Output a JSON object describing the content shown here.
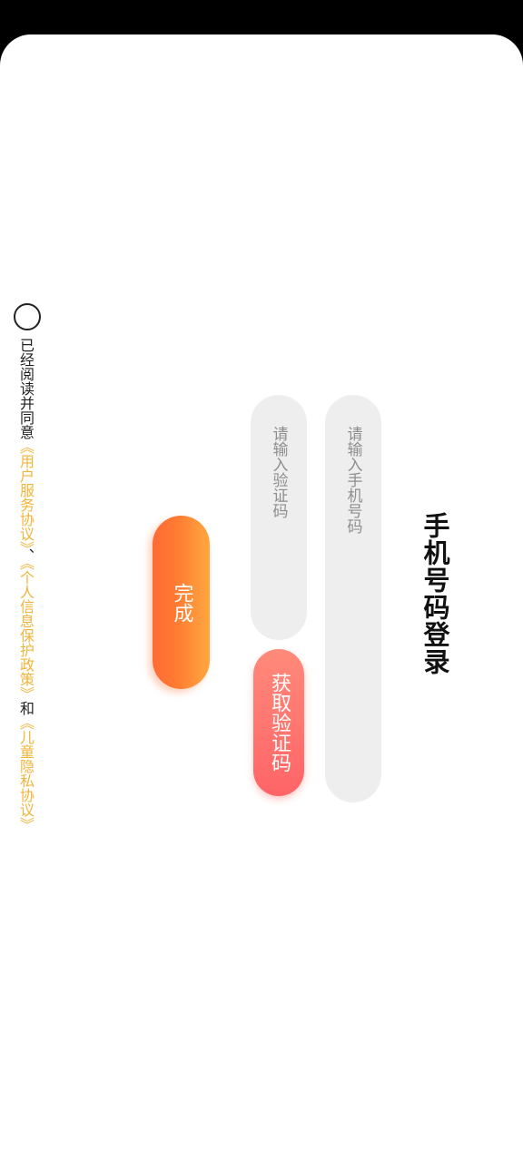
{
  "title": "手机号码登录",
  "phone_input": {
    "placeholder": "请输入手机号码"
  },
  "code_input": {
    "placeholder": "请输入验证码"
  },
  "get_code_button": {
    "label": "获取验证码"
  },
  "done_button": {
    "label": "完成"
  },
  "agreement": {
    "prefix": "已经阅读并同意",
    "link_user_service": "《用户服务协议》",
    "separator": "、",
    "link_privacy": "《个人信息保护政策》",
    "and": "和",
    "link_children": "《儿童隐私协议》",
    "checked": false
  },
  "colors": {
    "link": "#f2b43a",
    "get_code_button": "#ff6f6d",
    "done_button": "#ff7a33",
    "field_background": "#eeeeee"
  }
}
